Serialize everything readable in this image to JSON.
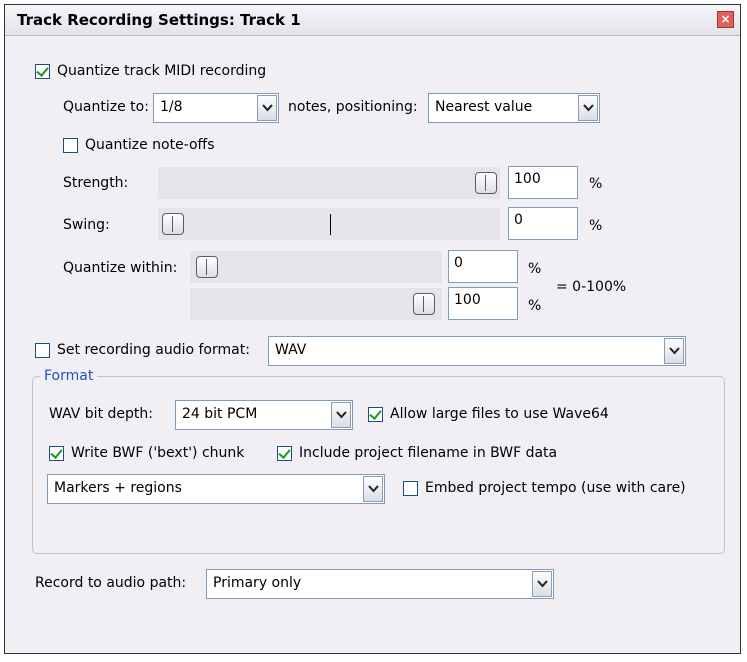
{
  "window": {
    "title": "Track Recording Settings: Track 1",
    "close_glyph": "×"
  },
  "quantize": {
    "enabled_label": "Quantize track MIDI recording",
    "enabled": true,
    "to_label": "Quantize to:",
    "to_value": "1/8",
    "positioning_label": "notes, positioning:",
    "positioning_value": "Nearest value",
    "note_offs_label": "Quantize note-offs",
    "note_offs": false,
    "strength_label": "Strength:",
    "strength_value": "100",
    "strength_unit": "%",
    "strength_level": 1.0,
    "swing_label": "Swing:",
    "swing_value": "0",
    "swing_unit": "%",
    "swing_level": 0.0,
    "within_label": "Quantize within:",
    "within_min_value": "0",
    "within_max_value": "100",
    "within_unit": "%",
    "within_range_label": "= 0-100%",
    "within_min_level": 0.0,
    "within_max_level": 1.0
  },
  "audio_format": {
    "enabled_label": "Set recording audio format:",
    "enabled": false,
    "format_value": "WAV"
  },
  "format_group": {
    "label": "Format",
    "bit_depth_label": "WAV bit depth:",
    "bit_depth_value": "24 bit PCM",
    "large_files_label": "Allow large files to use Wave64",
    "large_files": true,
    "bwf_label": "Write BWF ('bext') chunk",
    "bwf": true,
    "project_filename_label": "Include project filename in BWF data",
    "project_filename": true,
    "markers_value": "Markers + regions",
    "tempo_label": "Embed project tempo (use with care)",
    "tempo": false
  },
  "record_path": {
    "label": "Record to audio path:",
    "value": "Primary only"
  },
  "colors": {
    "accent": "#2150c0",
    "background": "#f1eff4",
    "check": "#1a9a1a",
    "close": "#e0605a"
  },
  "icons": [
    "check-icon",
    "dropdown-arrow-icon",
    "close-icon"
  ]
}
